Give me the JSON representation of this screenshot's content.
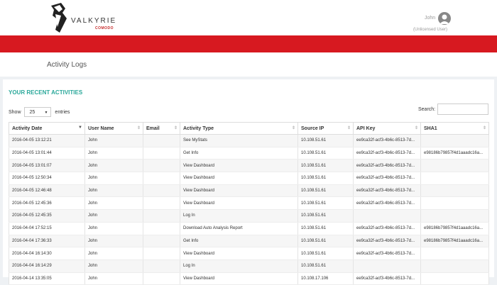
{
  "brand": {
    "name": "VALKYRIE",
    "sub": "COMODO"
  },
  "user": {
    "name": "John",
    "status": "(Unlicensed User)"
  },
  "page": {
    "title": "Activity Logs"
  },
  "panel": {
    "title": "YOUR RECENT ACTIVITIES"
  },
  "controls": {
    "show_label": "Show",
    "entries_value": "25",
    "entries_label": "entries",
    "search_label": "Search:"
  },
  "table": {
    "columns": [
      "Activity Date",
      "User Name",
      "Email",
      "Activity Type",
      "Source IP",
      "API Key",
      "SHA1"
    ],
    "rows": [
      [
        "2016-04-05 13:12:21",
        "John",
        "",
        "See MyStats",
        "10.108.51.61",
        "ee9ca32f-acf3-4b6c-8513-7d...",
        ""
      ],
      [
        "2016-04-05 13:01:44",
        "John",
        "",
        "Get Info",
        "10.108.51.61",
        "ee9ca32f-acf3-4b6c-8513-7d...",
        "e98186b79857f4d1aaadc16a..."
      ],
      [
        "2016-04-05 13:01:07",
        "John",
        "",
        "View Dashboard",
        "10.108.51.61",
        "ee9ca32f-acf3-4b6c-8513-7d...",
        ""
      ],
      [
        "2016-04-05 12:50:34",
        "John",
        "",
        "View Dashboard",
        "10.108.51.61",
        "ee9ca32f-acf3-4b6c-8513-7d...",
        ""
      ],
      [
        "2016-04-05 12:46:48",
        "John",
        "",
        "View Dashboard",
        "10.108.51.61",
        "ee9ca32f-acf3-4b6c-8513-7d...",
        ""
      ],
      [
        "2016-04-05 12:45:36",
        "John",
        "",
        "View Dashboard",
        "10.108.51.61",
        "ee9ca32f-acf3-4b6c-8513-7d...",
        ""
      ],
      [
        "2016-04-05 12:45:35",
        "John",
        "",
        "Log In",
        "10.108.51.61",
        "",
        ""
      ],
      [
        "2016-04-04 17:52:15",
        "John",
        "",
        "Download Auto Analysis Report",
        "10.108.51.61",
        "ee9ca32f-acf3-4b6c-8513-7d...",
        "e98186b79857f4d1aaadc16a..."
      ],
      [
        "2016-04-04 17:36:33",
        "John",
        "",
        "Get Info",
        "10.108.51.61",
        "ee9ca32f-acf3-4b6c-8513-7d...",
        "e98186b79857f4d1aaadc16a..."
      ],
      [
        "2016-04-04 16:14:30",
        "John",
        "",
        "View Dashboard",
        "10.108.51.61",
        "ee9ca32f-acf3-4b6c-8513-7d...",
        ""
      ],
      [
        "2016-04-04 16:14:29",
        "John",
        "",
        "Log In",
        "10.108.51.61",
        "",
        ""
      ],
      [
        "2016-04-14 13:35:05",
        "John",
        "",
        "View Dashboard",
        "10.108.17.106",
        "ee9ca32f-acf3-4b6c-8513-7d...",
        ""
      ]
    ]
  },
  "colors": {
    "accent_red": "#d71920",
    "title_teal": "#2aa89a"
  }
}
